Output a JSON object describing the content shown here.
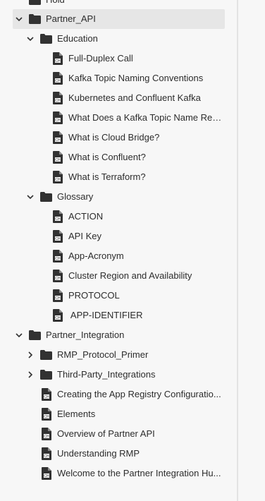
{
  "tree": {
    "top_partial": {
      "label": "Hold"
    },
    "partner_api": {
      "label": "Partner_API",
      "education": {
        "label": "Education",
        "items": [
          "Full-Duplex Call",
          "Kafka Topic Naming Conventions",
          "Kubernetes and Confluent Kafka",
          "What Does a Kafka Topic Name Rep...",
          "What is Cloud Bridge?",
          "What is Confluent?",
          "What is Terraform?"
        ]
      },
      "glossary": {
        "label": "Glossary",
        "items": [
          "ACTION",
          "API Key",
          "App-Acronym",
          "Cluster Region and Availability",
          "PROTOCOL",
          " APP-IDENTIFIER"
        ]
      }
    },
    "partner_integration": {
      "label": "Partner_Integration",
      "folders": [
        "RMP_Protocol_Primer",
        "Third-Party_Integrations"
      ],
      "items": [
        "Creating the App Registry Configuratio...",
        "Elements",
        "Overview of Partner API",
        "Understanding RMP",
        "Welcome to the Partner Integration Hu..."
      ]
    }
  }
}
